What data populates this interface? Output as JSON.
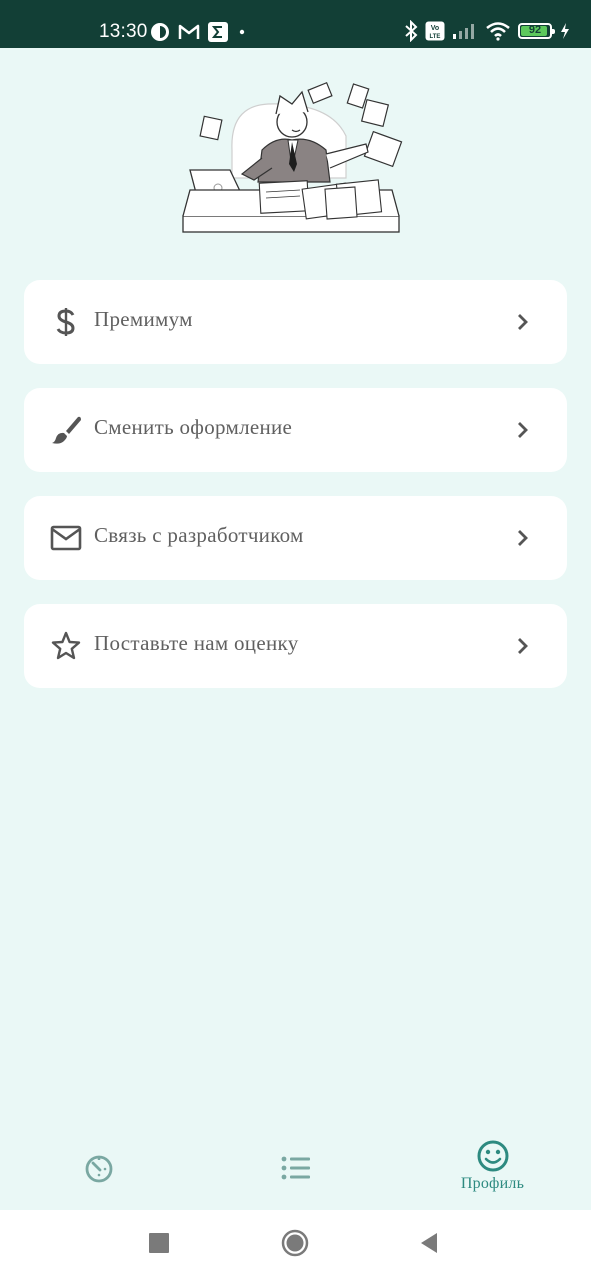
{
  "status_bar": {
    "time": "13:30",
    "battery": 92,
    "left_icons": [
      "vpn-icon",
      "gmail-icon",
      "sigma-icon",
      "dot-icon"
    ],
    "right_icons": [
      "bluetooth-icon",
      "volte-icon",
      "cellular-signal-icon",
      "wifi-icon",
      "battery-icon",
      "charging-icon"
    ]
  },
  "menu": {
    "items": [
      {
        "label": "Премимум",
        "icon": "dollar-icon"
      },
      {
        "label": "Сменить оформление",
        "icon": "paintbrush-icon"
      },
      {
        "label": "Связь с разработчиком",
        "icon": "mail-icon"
      },
      {
        "label": "Поставьте нам оценку",
        "icon": "star-icon"
      }
    ]
  },
  "bottom_nav": {
    "tabs": [
      {
        "icon": "timer-icon",
        "label": ""
      },
      {
        "icon": "list-icon",
        "label": ""
      },
      {
        "icon": "smiley-icon",
        "label": "Профиль",
        "active": true
      }
    ]
  },
  "colors": {
    "status_bar_bg": "#123f36",
    "background": "#eaf8f6",
    "accent": "#2d8a80",
    "inactive_icon": "#7aa8a2",
    "menu_text": "#606060"
  }
}
